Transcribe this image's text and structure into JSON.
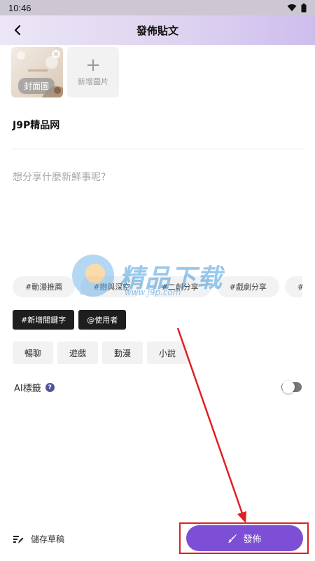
{
  "status_bar": {
    "time": "10:46"
  },
  "header": {
    "title": "發佈貼文"
  },
  "images": {
    "cover_label": "封面圖",
    "add_label": "新增圖片"
  },
  "post": {
    "title": "J9P精品网",
    "content_placeholder": "想分享什麼新鮮事呢?"
  },
  "tags": [
    "#動漫推薦",
    "#戀與深空",
    "#二創分享",
    "#戲劇分享",
    "#BL推"
  ],
  "actions": {
    "add_keyword": "#新增關鍵字",
    "mention_user": "@使用者"
  },
  "categories": [
    "暢聊",
    "遊戲",
    "動漫",
    "小說"
  ],
  "ai_tags": {
    "label": "AI標籤",
    "help": "?",
    "enabled": false
  },
  "watermark": {
    "text": "精品下载",
    "url": "www.j9p.com"
  },
  "footer": {
    "draft_label": "儲存草稿",
    "publish_label": "發佈"
  },
  "colors": {
    "accent": "#7d4fd6",
    "annotation": "#e02020",
    "header_gradient_end": "#cdbdee"
  }
}
